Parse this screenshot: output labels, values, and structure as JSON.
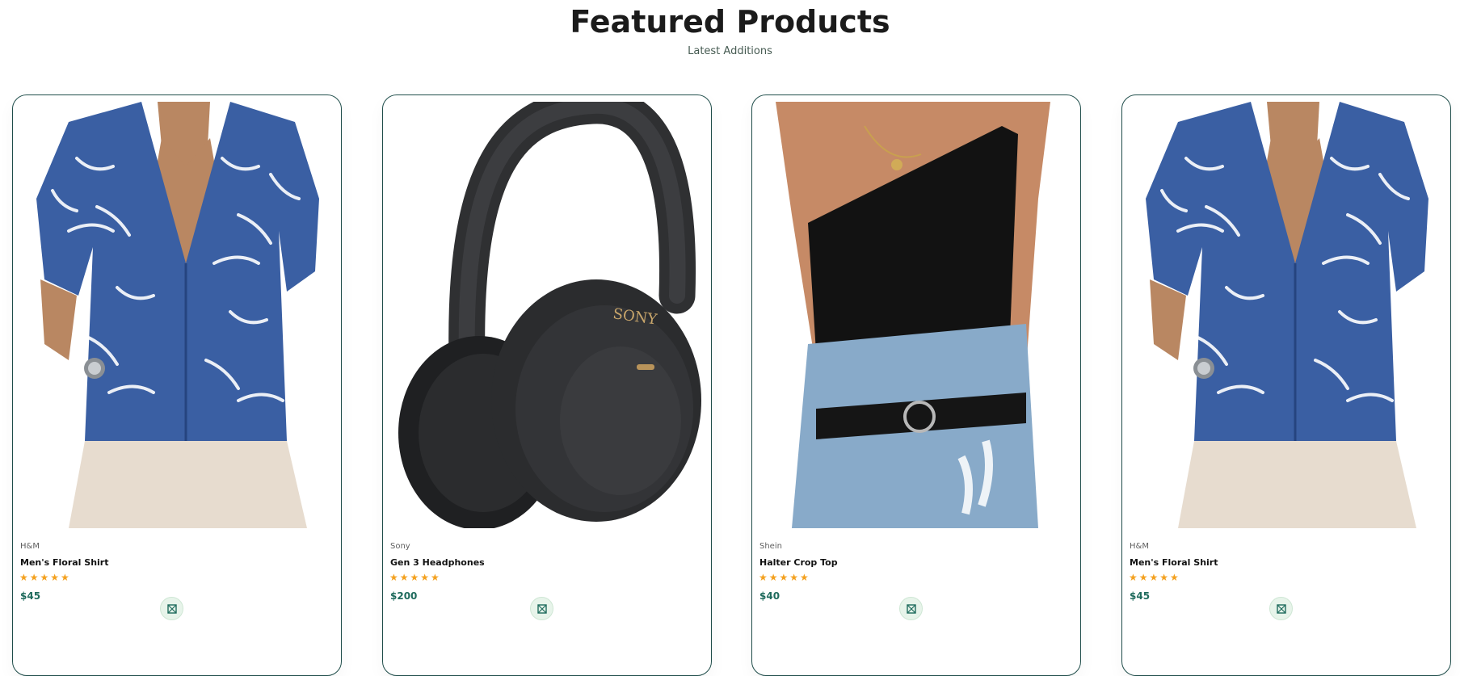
{
  "section": {
    "title": "Featured Products",
    "subtitle": "Latest Additions"
  },
  "products": [
    {
      "brand": "H&M",
      "name": "Men's Floral Shirt",
      "rating": 5,
      "stars": "★★★★★",
      "price": "$45",
      "image_icon": "floral-shirt-image",
      "cart_icon": "cart-icon"
    },
    {
      "brand": "Sony",
      "name": "Gen 3 Headphones",
      "rating": 5,
      "stars": "★★★★★",
      "price": "$200",
      "image_icon": "headphones-image",
      "image_logo_text": "SONY",
      "cart_icon": "cart-icon"
    },
    {
      "brand": "Shein",
      "name": "Halter Crop Top",
      "rating": 5,
      "stars": "★★★★★",
      "price": "$40",
      "image_icon": "crop-top-image",
      "cart_icon": "cart-icon"
    },
    {
      "brand": "H&M",
      "name": "Men's Floral Shirt",
      "rating": 5,
      "stars": "★★★★★",
      "price": "$45",
      "image_icon": "floral-shirt-image",
      "cart_icon": "cart-icon"
    }
  ],
  "colors": {
    "accent": "#1f6b5d",
    "star": "#f4a11f",
    "card_border": "#1f4d4a",
    "cart_bg": "#e7f4ea"
  }
}
